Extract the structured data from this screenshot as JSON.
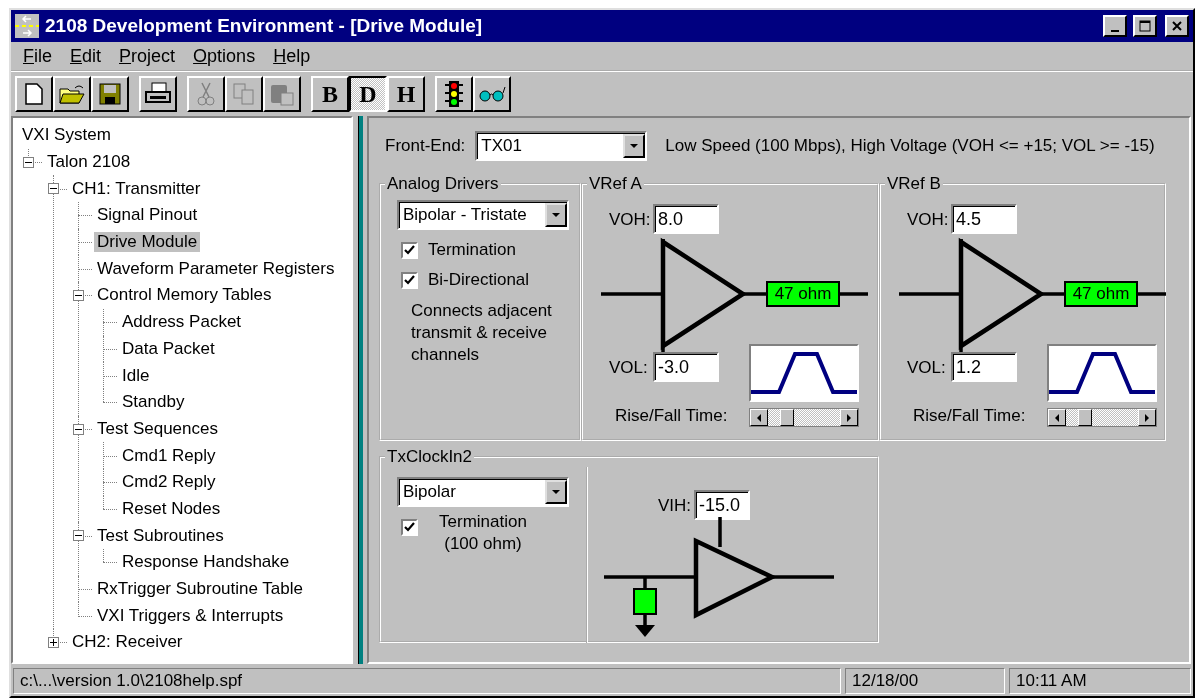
{
  "window": {
    "title": "2108 Development Environment - [Drive Module]"
  },
  "menu": [
    {
      "label": "File"
    },
    {
      "label": "Edit"
    },
    {
      "label": "Project"
    },
    {
      "label": "Options"
    },
    {
      "label": "Help"
    }
  ],
  "toolbar": [
    [
      {
        "kind": "new",
        "disabled": false
      },
      {
        "kind": "open",
        "disabled": false
      },
      {
        "kind": "save",
        "disabled": false
      }
    ],
    [
      {
        "kind": "print",
        "disabled": false
      }
    ],
    [
      {
        "kind": "cut",
        "disabled": true
      },
      {
        "kind": "copy",
        "disabled": true
      },
      {
        "kind": "paste",
        "disabled": true
      }
    ],
    [
      {
        "kind": "mode",
        "label": "B",
        "selected": false,
        "disabled": false
      },
      {
        "kind": "mode",
        "label": "D",
        "selected": true,
        "disabled": false
      },
      {
        "kind": "mode",
        "label": "H",
        "selected": false,
        "disabled": false
      }
    ],
    [
      {
        "kind": "traffic-light",
        "disabled": false
      },
      {
        "kind": "glasses",
        "disabled": false
      }
    ]
  ],
  "tree": [
    {
      "label": "VXI System",
      "kind": "root",
      "selected": false
    },
    {
      "label": "Talon 2108",
      "selected": false,
      "expanded": true,
      "children": [
        {
          "label": "CH1: Transmitter",
          "selected": false,
          "expanded": true,
          "children": [
            {
              "label": "Signal Pinout",
              "selected": false
            },
            {
              "label": "Drive Module",
              "selected": true
            },
            {
              "label": "Waveform Parameter Registers",
              "selected": false
            },
            {
              "label": "Control Memory Tables",
              "selected": false,
              "expanded": true,
              "children": [
                {
                  "label": "Address Packet",
                  "selected": false
                },
                {
                  "label": "Data Packet",
                  "selected": false
                },
                {
                  "label": "Idle",
                  "selected": false
                },
                {
                  "label": "Standby",
                  "selected": false
                }
              ]
            },
            {
              "label": "Test Sequences",
              "selected": false,
              "expanded": true,
              "children": [
                {
                  "label": "Cmd1 Reply",
                  "selected": false
                },
                {
                  "label": "Cmd2 Reply",
                  "selected": false
                },
                {
                  "label": "Reset Nodes",
                  "selected": false
                }
              ]
            },
            {
              "label": "Test Subroutines",
              "selected": false,
              "expanded": true,
              "children": [
                {
                  "label": "Response Handshake",
                  "selected": false
                }
              ]
            },
            {
              "label": "RxTrigger Subroutine Table",
              "selected": false
            },
            {
              "label": "VXI Triggers & Interrupts",
              "selected": false
            }
          ]
        },
        {
          "label": "CH2: Receiver",
          "selected": false,
          "expanded": false
        }
      ]
    }
  ],
  "front_end": {
    "label": "Front-End:",
    "value": "TX01",
    "description": "Low Speed (100 Mbps), High Voltage (VOH <= +15; VOL >= -15)"
  },
  "analog_drivers": {
    "title": "Analog Drivers",
    "mode": "Bipolar - Tristate",
    "options": [
      {
        "label": "Termination",
        "checked": true
      },
      {
        "label": "Bi-Directional",
        "checked": true
      }
    ],
    "note": "Connects adjacent transmit & receive channels"
  },
  "vrefs": [
    {
      "title": "VRef A",
      "voh_label": "VOH:",
      "voh": "8.0",
      "resistor": "47 ohm",
      "vol_label": "VOL:",
      "vol": "-3.0",
      "rise_fall_label": "Rise/Fall Time:",
      "level": 0.2
    },
    {
      "title": "VRef B",
      "voh_label": "VOH:",
      "voh": "4.5",
      "resistor": "47 ohm",
      "vol_label": "VOL:",
      "vol": "1.2",
      "rise_fall_label": "Rise/Fall Time:",
      "level": 0.2
    }
  ],
  "tx_clock": {
    "title": "TxClockIn2",
    "mode": "Bipolar",
    "termination": {
      "label": "Termination (100 ohm)",
      "checked": true
    },
    "vih_label": "VIH:",
    "vih": "-15.0"
  },
  "status_bar": {
    "path": "c:\\...\\version 1.0\\2108help.spf",
    "date": "12/18/00",
    "time": "10:11 AM"
  }
}
